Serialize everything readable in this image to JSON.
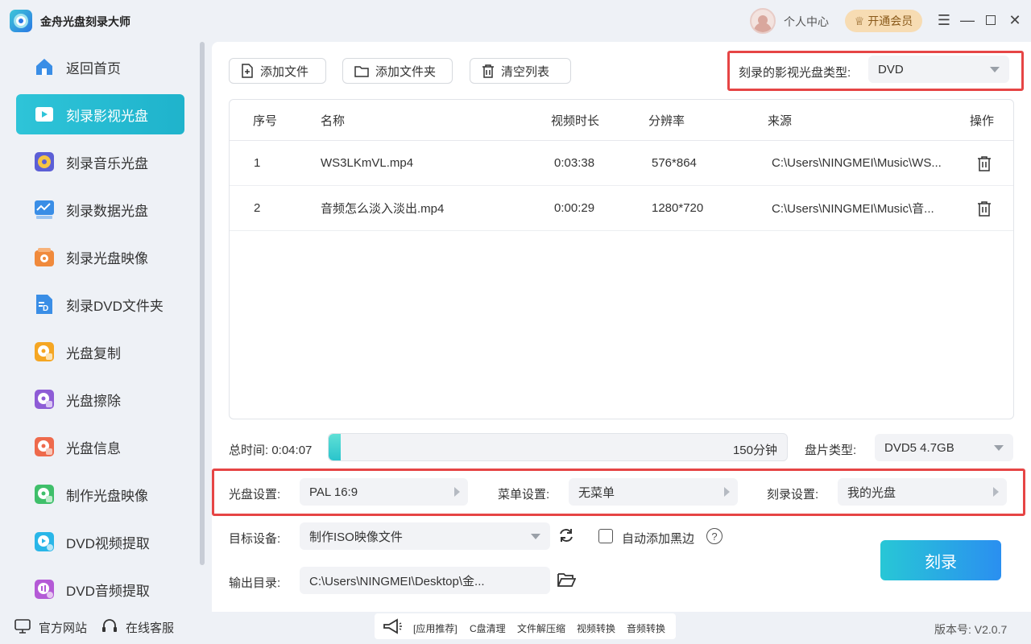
{
  "app": {
    "title": "金舟光盘刻录大师"
  },
  "header": {
    "user_center": "个人中心",
    "vip_label": "开通会员"
  },
  "sidebar": {
    "items": [
      {
        "label": "返回首页",
        "icon": "home-icon",
        "color": "#3a8ee6"
      },
      {
        "label": "刻录影视光盘",
        "icon": "video-disc-icon",
        "color": "#ffffff"
      },
      {
        "label": "刻录音乐光盘",
        "icon": "music-disc-icon",
        "color": "#5c5fd6"
      },
      {
        "label": "刻录数据光盘",
        "icon": "data-disc-icon",
        "color": "#3a8ee6"
      },
      {
        "label": "刻录光盘映像",
        "icon": "disc-image-icon",
        "color": "#f08a3c"
      },
      {
        "label": "刻录DVD文件夹",
        "icon": "dvd-folder-icon",
        "color": "#3a8ee6"
      },
      {
        "label": "光盘复制",
        "icon": "disc-copy-icon",
        "color": "#f5a623"
      },
      {
        "label": "光盘擦除",
        "icon": "disc-erase-icon",
        "color": "#8e5cd6"
      },
      {
        "label": "光盘信息",
        "icon": "disc-info-icon",
        "color": "#ee6a4c"
      },
      {
        "label": "制作光盘映像",
        "icon": "make-image-icon",
        "color": "#3fbf6a"
      },
      {
        "label": "DVD视频提取",
        "icon": "dvd-video-extract-icon",
        "color": "#29b6e8"
      },
      {
        "label": "DVD音频提取",
        "icon": "dvd-audio-extract-icon",
        "color": "#b45ad6"
      }
    ],
    "active_index": 1
  },
  "toolbar": {
    "add_file": "添加文件",
    "add_folder": "添加文件夹",
    "clear_list": "清空列表"
  },
  "disc_type": {
    "label": "刻录的影视光盘类型:",
    "value": "DVD"
  },
  "table": {
    "headers": {
      "index": "序号",
      "name": "名称",
      "duration": "视频时长",
      "resolution": "分辨率",
      "source": "来源",
      "action": "操作"
    },
    "rows": [
      {
        "index": "1",
        "name": "WS3LKmVL.mp4",
        "duration": "0:03:38",
        "resolution": "576*864",
        "source": "C:\\Users\\NINGMEI\\Music\\WS..."
      },
      {
        "index": "2",
        "name": "音频怎么淡入淡出.mp4",
        "duration": "0:00:29",
        "resolution": "1280*720",
        "source": "C:\\Users\\NINGMEI\\Music\\音..."
      }
    ]
  },
  "capacity": {
    "total_time": "总时间: 0:04:07",
    "limit_label": "150分钟",
    "fill_fraction": 0.027
  },
  "disc_kind": {
    "label": "盘片类型:",
    "value": "DVD5 4.7GB"
  },
  "settings": {
    "disc": {
      "label": "光盘设置:",
      "value": "PAL 16:9"
    },
    "menu": {
      "label": "菜单设置:",
      "value": "无菜单"
    },
    "burn": {
      "label": "刻录设置:",
      "value": "我的光盘"
    }
  },
  "target": {
    "label": "目标设备:",
    "value": "制作ISO映像文件",
    "auto_black_label": "自动添加黑边"
  },
  "output": {
    "label": "输出目录:",
    "value": "C:\\Users\\NINGMEI\\Desktop\\金..."
  },
  "burn_button": "刻录",
  "footer": {
    "website": "官方网站",
    "service": "在线客服",
    "promo": [
      "[应用推荐]",
      "C盘清理",
      "文件解压缩",
      "视频转换",
      "音频转换"
    ],
    "version": "版本号: V2.0.7"
  }
}
